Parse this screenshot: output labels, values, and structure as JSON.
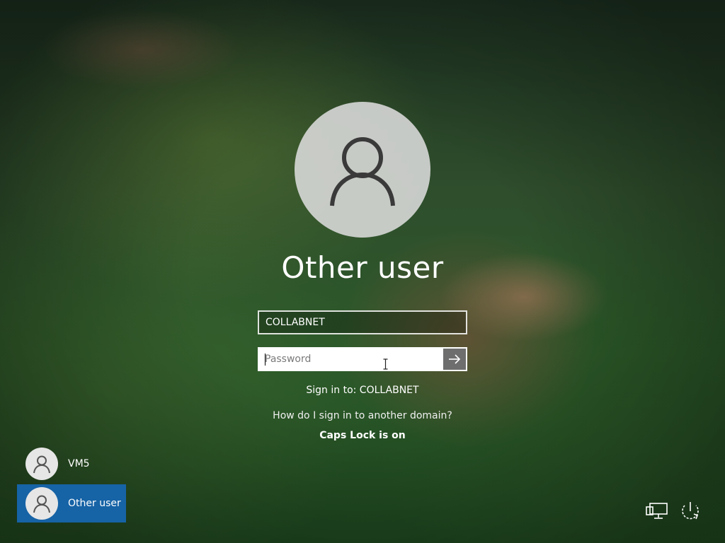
{
  "login": {
    "title": "Other user",
    "username_value": "COLLABNET",
    "password_placeholder": "Password",
    "submit_icon": "arrow-right-icon",
    "sign_in_to": "Sign in to: COLLABNET",
    "domain_help_link": "How do I sign in to another domain?",
    "caps_lock_warning": "Caps Lock is on"
  },
  "user_list": [
    {
      "label": "VM5",
      "icon": "user-icon",
      "selected": false
    },
    {
      "label": "Other user",
      "icon": "user-icon",
      "selected": true
    }
  ],
  "tray": {
    "network_icon": "network-icon",
    "power_icon": "power-icon",
    "accessibility_icon": "ease-of-access-icon"
  },
  "colors": {
    "selected_tile": "#1663a6",
    "submit_button": "#6e6e6e",
    "avatar_bg": "#dcdcdc"
  }
}
